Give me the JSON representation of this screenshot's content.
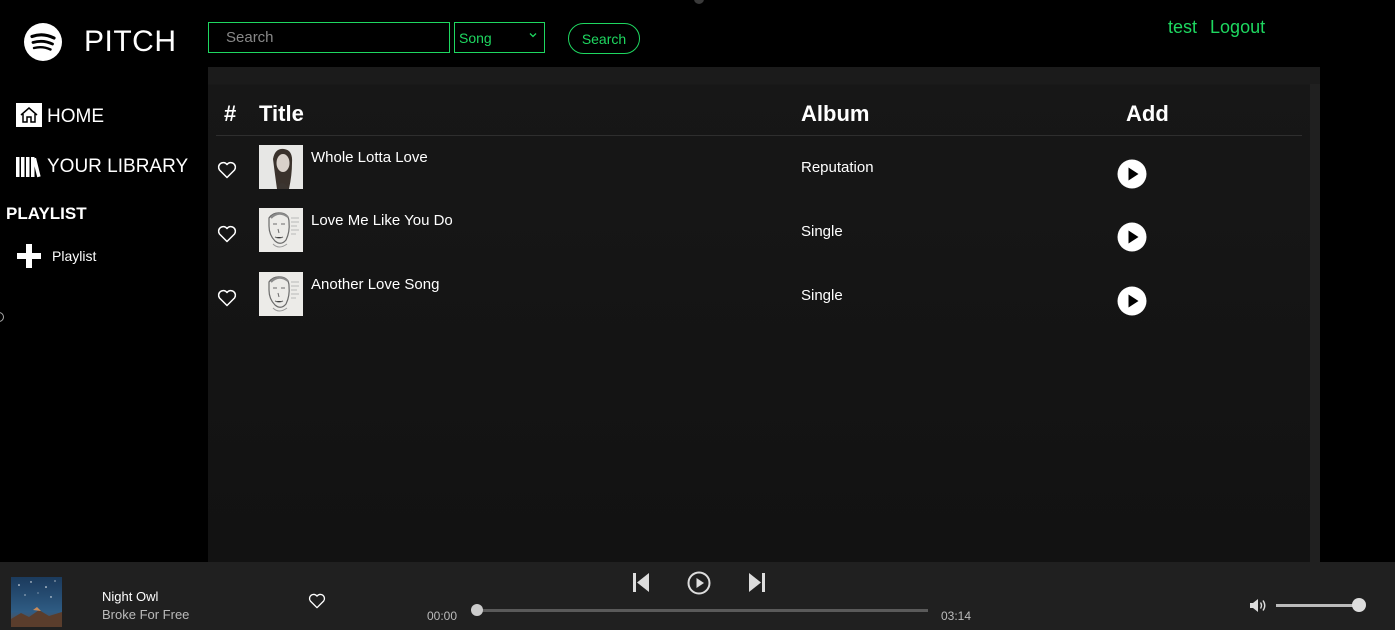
{
  "app": {
    "brand": "PITCH",
    "colors": {
      "accent": "#1ed760",
      "background": "#000000",
      "panel": "#121212",
      "player": "#202020"
    }
  },
  "header": {
    "search_placeholder": "Search",
    "search_value": "",
    "search_type": "Song",
    "search_button": "Search",
    "username": "test",
    "logout": "Logout"
  },
  "sidebar": {
    "home": {
      "label": "HOME",
      "icon": "home-icon"
    },
    "library": {
      "label": "YOUR LIBRARY",
      "icon": "library-icon"
    },
    "playlist_heading": "PLAYLIST",
    "add_playlist": {
      "label": "Playlist",
      "icon": "plus-icon"
    }
  },
  "table": {
    "headers": {
      "num": "#",
      "title": "Title",
      "album": "Album",
      "add": "Add"
    },
    "rows": [
      {
        "title": "Whole Lotta Love",
        "album": "Reputation"
      },
      {
        "title": "Love Me Like You Do",
        "album": "Single"
      },
      {
        "title": "Another Love Song",
        "album": "Single"
      }
    ]
  },
  "player": {
    "title": "Night Owl",
    "artist": "Broke For Free",
    "current_time": "00:00",
    "total_time": "03:14",
    "progress": 0.0,
    "volume": 1.0
  }
}
